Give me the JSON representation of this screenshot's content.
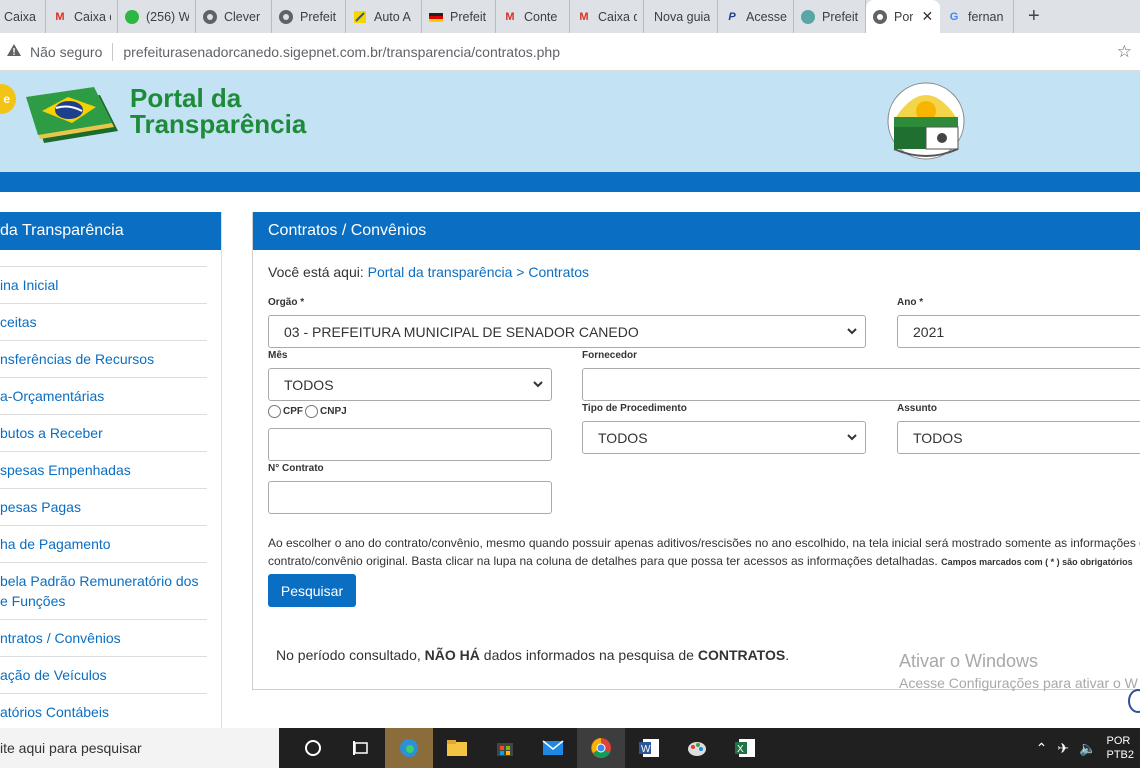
{
  "browser": {
    "tabs": [
      {
        "title": "Caixa d",
        "icon": "gmail-icon",
        "w": 0
      },
      {
        "title": "Caixa d",
        "icon": "gmail-icon"
      },
      {
        "title": "(256) W",
        "icon": "whatsapp-icon"
      },
      {
        "title": "Clever",
        "icon": "globe-icon"
      },
      {
        "title": "Prefeit",
        "icon": "globe-icon"
      },
      {
        "title": "Auto A",
        "icon": "bank-icon"
      },
      {
        "title": "Prefeit",
        "icon": "flag-icon"
      },
      {
        "title": "Conte",
        "icon": "gmail-icon"
      },
      {
        "title": "Caixa d",
        "icon": "gmail-icon"
      },
      {
        "title": "Nova guia",
        "icon": ""
      },
      {
        "title": "Acesse",
        "icon": "paypal-icon"
      },
      {
        "title": "Prefeit",
        "icon": "globe-icon"
      },
      {
        "title": "Por",
        "icon": "globe-icon",
        "active": true
      },
      {
        "title": "fernan",
        "icon": "google-icon"
      }
    ],
    "new_tab": "+",
    "close": "✕",
    "security": "Não seguro",
    "url": "prefeiturasenadorcanedo.sigepnet.com.br/transparencia/contratos.php"
  },
  "header": {
    "badge": "e",
    "title_line1": "Portal da",
    "title_line2": "Transparência"
  },
  "sidebar": {
    "heading": "da Transparência",
    "items": [
      "ina Inicial",
      "ceitas",
      "nsferências de Recursos",
      "a-Orçamentárias",
      "butos a Receber",
      "spesas Empenhadas",
      "pesas Pagas",
      "ha de Pagamento",
      "bela Padrão Remuneratório dos",
      "e Funções",
      "ntratos / Convênios",
      "ação de Veículos",
      "atórios Contábeis"
    ]
  },
  "main": {
    "heading": "Contratos / Convênios",
    "breadcrumb_prefix": "Você está aqui:",
    "breadcrumb_link": "Portal da transparência > Contratos",
    "orgao_label": "Orgão *",
    "orgao_value": "03 - PREFEITURA MUNICIPAL DE SENADOR CANEDO",
    "ano_label": "Ano *",
    "ano_value": "2021",
    "mes_label": "Mês",
    "mes_value": "TODOS",
    "fornecedor_label": "Fornecedor",
    "fornecedor_value": "",
    "cpf_label": "CPF",
    "cnpj_label": "CNPJ",
    "cpf_value": "",
    "tipo_label": "Tipo de Procedimento",
    "tipo_value": "TODOS",
    "assunto_label": "Assunto",
    "assunto_value": "TODOS",
    "contrato_label": "N° Contrato",
    "contrato_value": "",
    "note_line1": "Ao escolher o ano do contrato/convênio, mesmo quando possuir apenas aditivos/rescisões no ano escolhido, na tela inicial será mostrado somente as informações do",
    "note_line2": "contrato/convênio original. Basta clicar na lupa na coluna de detalhes para que possa ter acessos as informações detalhadas.",
    "note_small": "Campos marcados com ( * ) são obrigatórios",
    "search_button": "Pesquisar",
    "result_prefix": "No período consultado,",
    "result_bold1": "NÃO HÁ",
    "result_mid": "dados informados na pesquisa de",
    "result_bold2": "CONTRATOS",
    "result_end": "."
  },
  "watermark": {
    "line1": "Ativar o Windows",
    "line2": "Acesse Configurações para ativar o W"
  },
  "taskbar": {
    "search_placeholder": "ite aqui para pesquisar",
    "lang_line1": "POR",
    "lang_line2": "PTB2"
  }
}
